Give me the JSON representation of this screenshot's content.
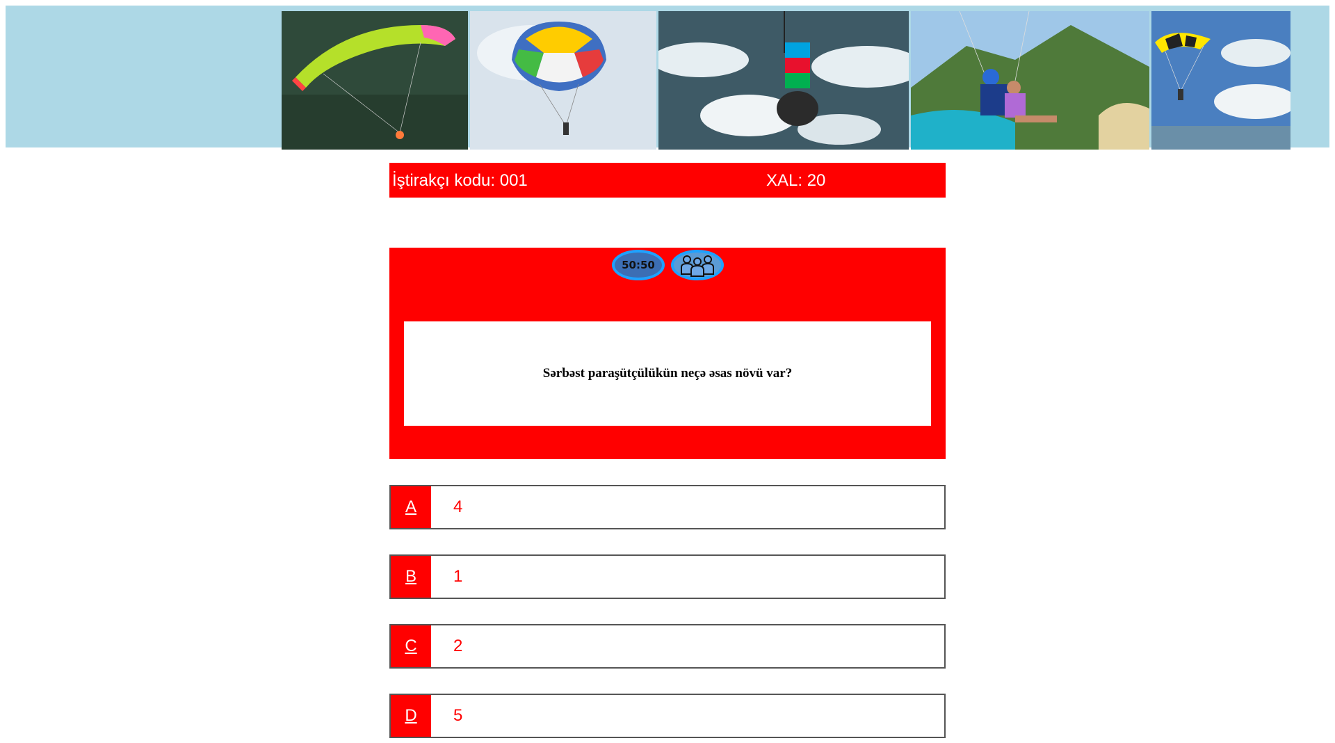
{
  "banner": {
    "photos": [
      {
        "subject": "paraglider over forest"
      },
      {
        "subject": "colorful parachute in sky"
      },
      {
        "subject": "parachute with Azerbaijan flag above clouds"
      },
      {
        "subject": "tandem paragliding over bay"
      },
      {
        "subject": "yellow-black parachute over sea"
      }
    ]
  },
  "info": {
    "participant_code": "İştirakçı kodu: 001",
    "score": "XAL: 20"
  },
  "lifelines": {
    "fifty_fifty_label": "50:50",
    "audience_icon": "audience-icon"
  },
  "question": {
    "text": "Sərbəst paraşütçülükün neçə əsas növü var?"
  },
  "answers": [
    {
      "letter": "A",
      "text": "4"
    },
    {
      "letter": "B",
      "text": "1"
    },
    {
      "letter": "C",
      "text": "2"
    },
    {
      "letter": "D",
      "text": "5"
    }
  ],
  "colors": {
    "accent": "#ff0000",
    "banner_bg": "#add8e6",
    "lifeline_border": "#1fa2ff"
  }
}
